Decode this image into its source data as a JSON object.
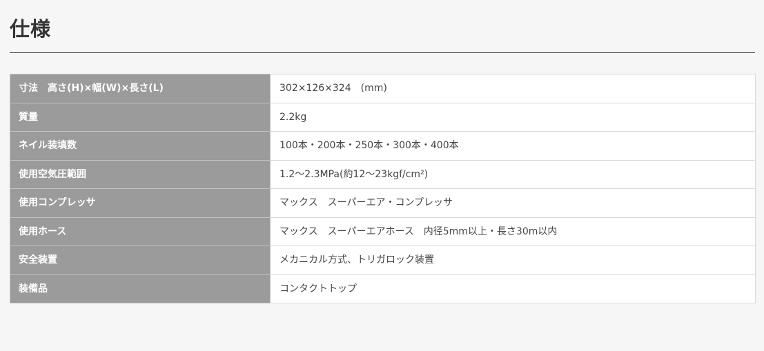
{
  "page": {
    "title": "仕様"
  },
  "spec_table": {
    "rows": [
      {
        "label": "寸法　高さ(H)×幅(W)×長さ(L)",
        "value": "302×126×324　(mm)"
      },
      {
        "label": "質量",
        "value": "2.2kg"
      },
      {
        "label": "ネイル装填数",
        "value": "100本・200本・250本・300本・400本"
      },
      {
        "label": "使用空気圧範囲",
        "value": "1.2〜2.3MPa(約12〜23kgf/cm²)"
      },
      {
        "label": "使用コンプレッサ",
        "value": "マックス　スーパーエア・コンプレッサ"
      },
      {
        "label": "使用ホース",
        "value": "マックス　スーパーエアホース　内径5mm以上・長さ30m以内"
      },
      {
        "label": "安全装置",
        "value": "メカニカル方式、トリガロック装置"
      },
      {
        "label": "装備品",
        "value": "コンタクトトップ"
      }
    ]
  },
  "colors": {
    "background": "#f6f6f6",
    "label_cell": "#9b9b9b",
    "value_cell": "#ffffff",
    "text": "#333333"
  }
}
